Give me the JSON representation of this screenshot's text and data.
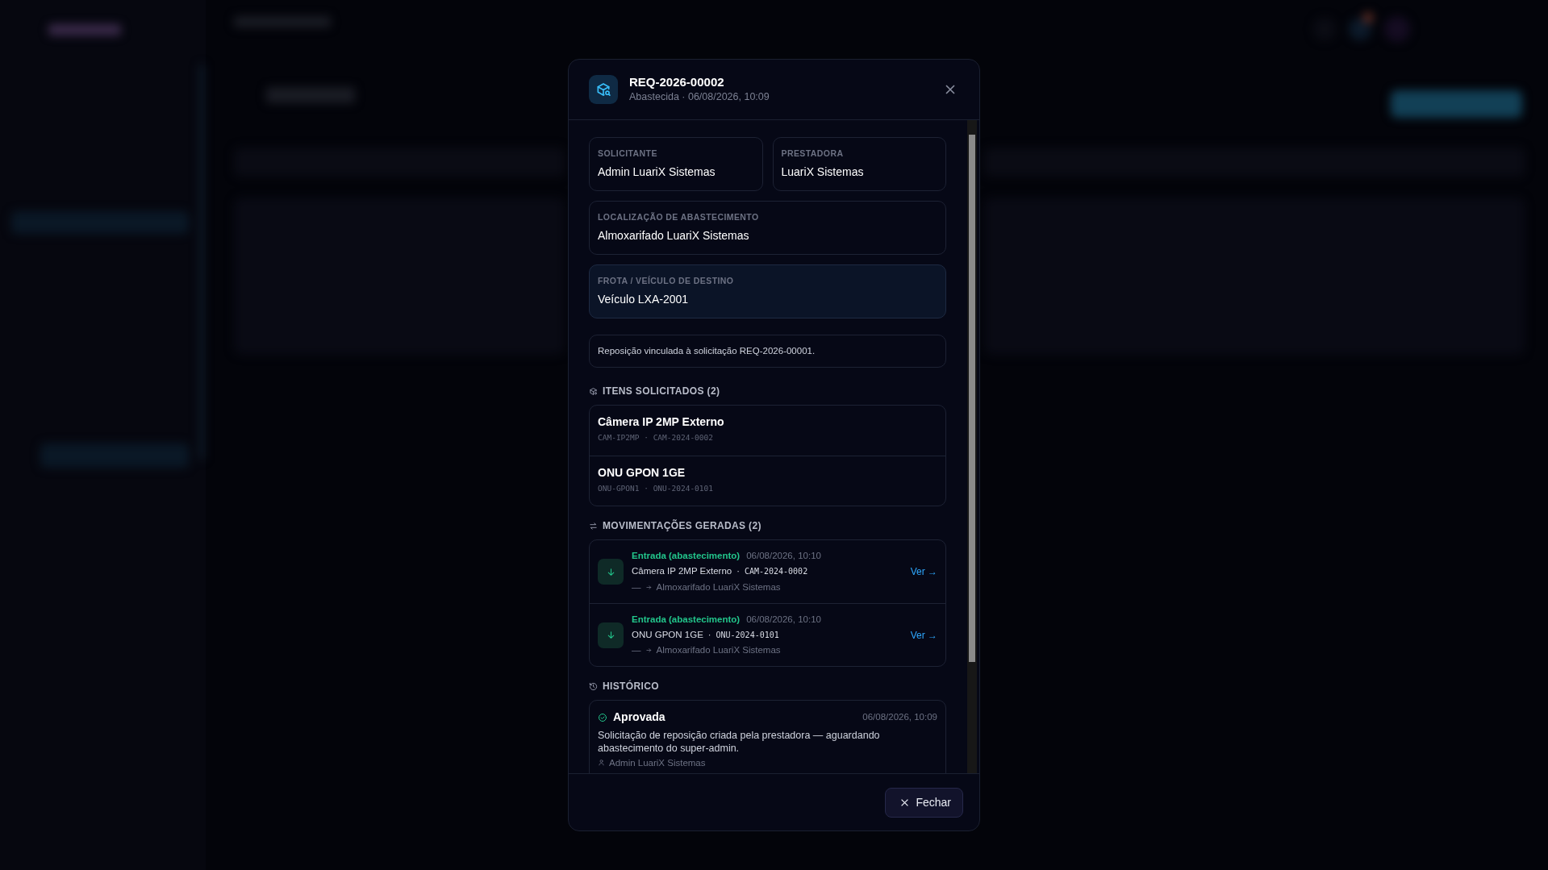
{
  "modal": {
    "title": "REQ-2026-00002",
    "subtitle": "Abastecida · 06/08/2026, 10:09",
    "fields": [
      {
        "label": "SOLICITANTE",
        "value": "Admin LuariX Sistemas",
        "highlighted": false
      },
      {
        "label": "PRESTADORA",
        "value": "LuariX Sistemas",
        "highlighted": false
      },
      {
        "label": "LOCALIZAÇÃO DE ABASTECIMENTO",
        "value": "Almoxarifado LuariX Sistemas",
        "highlighted": false
      },
      {
        "label": "FROTA / VEÍCULO DE DESTINO",
        "value": "Veículo LXA-2001",
        "highlighted": true
      }
    ],
    "note": "Reposição vinculada à solicitação REQ-2026-00001.",
    "items_section": {
      "title": "ITENS SOLICITADOS (2)",
      "items": [
        {
          "name": "Câmera IP 2MP Externo",
          "codes": "CAM-IP2MP · CAM-2024-0002"
        },
        {
          "name": "ONU GPON 1GE",
          "codes": "ONU-GPON1 · ONU-2024-0101"
        }
      ]
    },
    "movements_section": {
      "title": "MOVIMENTAÇÕES GERADAS (2)",
      "separator": "·",
      "movements": [
        {
          "kind": "entrada",
          "type": "Entrada (abastecimento)",
          "time": "06/08/2026, 10:10",
          "product": "Câmera IP 2MP Externo",
          "serial": "CAM-2024-0002",
          "from": "—",
          "to": "Almoxarifado LuariX Sistemas",
          "link": "Ver →"
        },
        {
          "kind": "entrada",
          "type": "Entrada (abastecimento)",
          "time": "06/08/2026, 10:10",
          "product": "ONU GPON 1GE",
          "serial": "ONU-2024-0101",
          "from": "—",
          "to": "Almoxarifado LuariX Sistemas",
          "link": "Ver →"
        }
      ]
    },
    "history_section": {
      "title": "HISTÓRICO",
      "entries": [
        {
          "kind": "approved",
          "status": "Aprovada",
          "time": "06/08/2026, 10:09",
          "description": "Solicitação de reposição criada pela prestadora — aguardando abastecimento do super-admin.",
          "author": "Admin LuariX Sistemas"
        }
      ]
    },
    "close_button": "Fechar"
  }
}
